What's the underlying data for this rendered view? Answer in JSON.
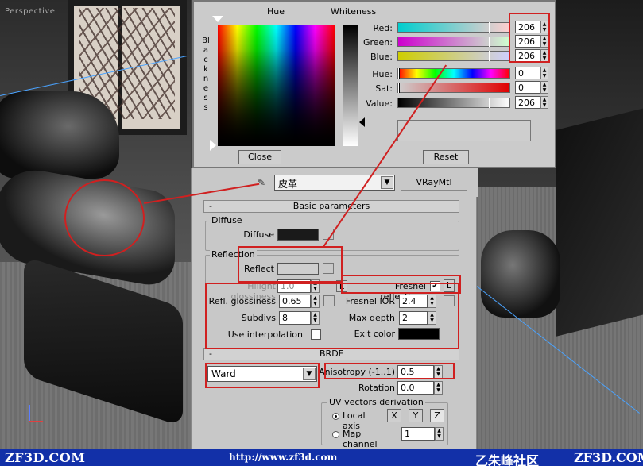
{
  "viewport": {
    "label": "Perspective"
  },
  "color_picker": {
    "hue_label": "Hue",
    "whiteness_label": "Whiteness",
    "blackness_label": "Blackness",
    "rows": [
      {
        "label": "Red:",
        "value": "206"
      },
      {
        "label": "Green:",
        "value": "206"
      },
      {
        "label": "Blue:",
        "value": "206"
      },
      {
        "label": "Hue:",
        "value": "0"
      },
      {
        "label": "Sat:",
        "value": "0"
      },
      {
        "label": "Value:",
        "value": "206"
      }
    ],
    "preview_color": "#cecece",
    "close_label": "Close",
    "reset_label": "Reset"
  },
  "material": {
    "name": "皮革",
    "type": "VRayMtl"
  },
  "basic_params": {
    "header": "Basic parameters",
    "diffuse_group": "Diffuse",
    "diffuse_label": "Diffuse",
    "diffuse_color": "#1a1a1a",
    "reflection_group": "Reflection",
    "reflect_label": "Reflect",
    "reflect_color": "#cecece",
    "hilight_label": "Hilight glossiness",
    "hilight_value": "1.0",
    "hilight_lock": "L",
    "fresnel_label": "Fresnel reflections",
    "fresnel_checked": "✔",
    "fresnel_lock": "L",
    "refl_gloss_label": "Refl. glossiness",
    "refl_gloss_value": "0.65",
    "fresnel_ior_label": "Fresnel IOR",
    "fresnel_ior_value": "2.4",
    "subdivs_label": "Subdivs",
    "subdivs_value": "8",
    "max_depth_label": "Max depth",
    "max_depth_value": "2",
    "use_interp_label": "Use interpolation",
    "exit_color_label": "Exit color",
    "exit_color": "#000000"
  },
  "brdf": {
    "header": "BRDF",
    "type": "Ward",
    "anisotropy_label": "Anisotropy (-1..1)",
    "anisotropy_value": "0.5",
    "rotation_label": "Rotation",
    "rotation_value": "0.0",
    "uv_group": "UV vectors derivation",
    "local_axis_label": "Local axis",
    "axis_x": "X",
    "axis_y": "Y",
    "axis_z": "Z",
    "map_channel_label": "Map channel",
    "map_channel_value": "1"
  },
  "watermark": {
    "left": "ZF3D.COM",
    "url": "http://www.zf3d.com",
    "cn": "乙朱峰社区",
    "right": "ZF3D.COM"
  },
  "annotation_color": "#d02020"
}
